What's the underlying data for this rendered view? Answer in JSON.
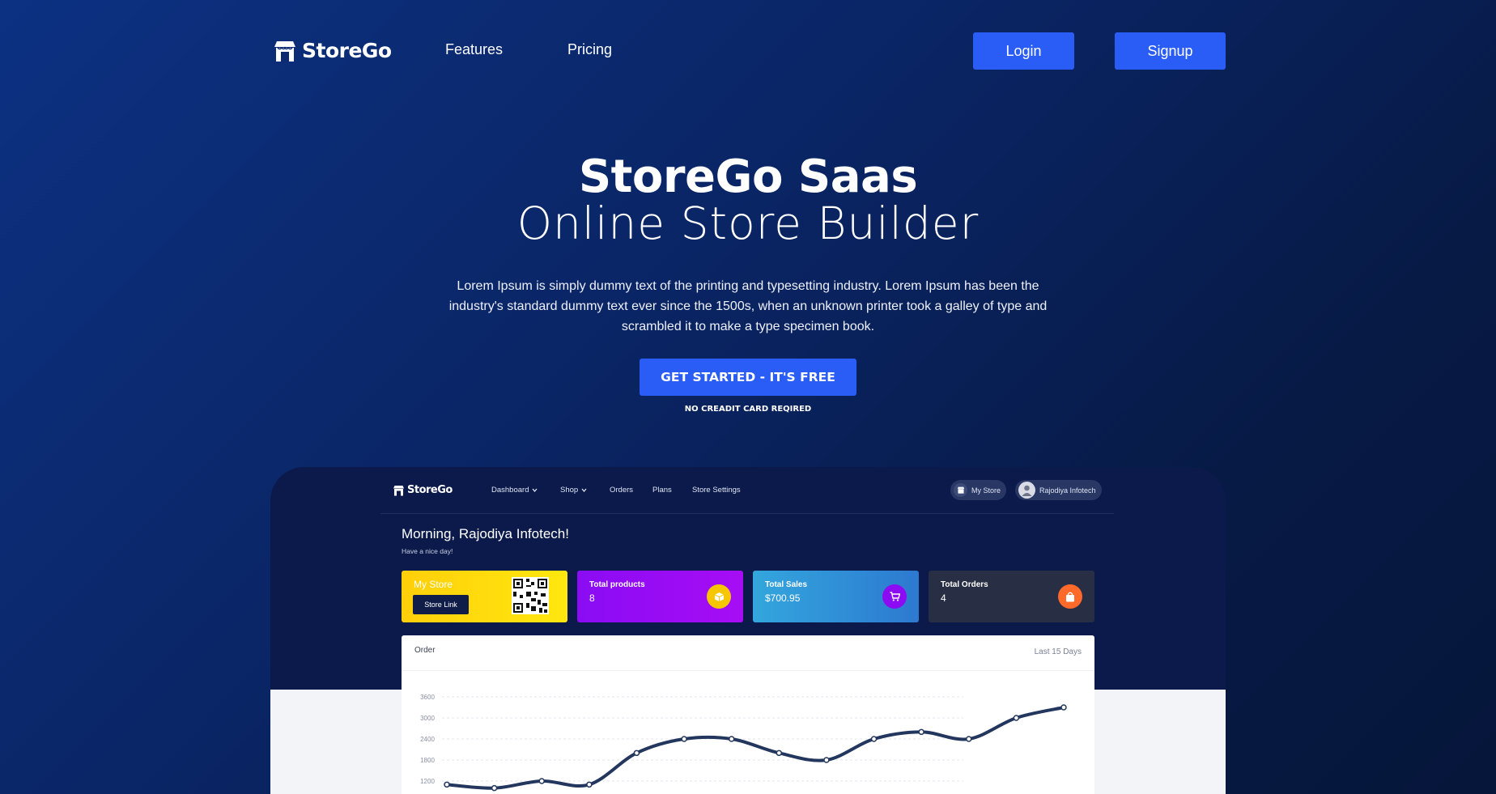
{
  "header": {
    "brand": "StoreGo",
    "nav": [
      {
        "label": "Features"
      },
      {
        "label": "Pricing"
      }
    ],
    "login_label": "Login",
    "signup_label": "Signup"
  },
  "hero": {
    "title_line1": "StoreGo Saas",
    "title_line2": "Online Store Builder",
    "description": "Lorem Ipsum is simply dummy text of the printing and typesetting industry. Lorem Ipsum has been the industry's standard dummy text ever since the 1500s, when an unknown printer took a galley of type and scrambled it to make a type specimen book.",
    "cta_label": "GET STARTED - IT'S FREE",
    "cta_note": "NO CREADIT CARD REQIRED"
  },
  "preview": {
    "brand": "StoreGo",
    "nav": [
      {
        "label": "Dashboard",
        "dropdown": true
      },
      {
        "label": "Shop",
        "dropdown": true
      },
      {
        "label": "Orders",
        "dropdown": false
      },
      {
        "label": "Plans",
        "dropdown": false
      },
      {
        "label": "Store Settings",
        "dropdown": false
      }
    ],
    "my_store_label": "My Store",
    "user_name": "Rajodiya Infotech",
    "greeting": "Morning, Rajodiya Infotech!",
    "greeting_sub": "Have a nice day!",
    "cards": {
      "my_store": {
        "title": "My Store",
        "button": "Store Link",
        "color": "#ffc40c"
      },
      "products": {
        "title": "Total products",
        "value": "8",
        "color": "#8b0cf3",
        "icon": "box-icon",
        "icon_color": "#f6c700"
      },
      "sales": {
        "title": "Total Sales",
        "value": "$700.95",
        "color": "#2f8fd8",
        "icon": "cart-icon",
        "icon_color": "#8b0cf3"
      },
      "orders": {
        "title": "Total Orders",
        "value": "4",
        "color": "#283044",
        "icon": "bag-icon",
        "icon_color": "#ff6a2a"
      }
    },
    "order_chart": {
      "title": "Order",
      "range_label": "Last 15 Days"
    }
  },
  "colors": {
    "accent": "#2a5cf6",
    "line": "#23365e"
  },
  "chart_data": {
    "type": "line",
    "title": "Order",
    "y_ticks": [
      3600,
      3000,
      2400,
      1800,
      1200
    ],
    "ylim": [
      1200,
      3600
    ],
    "series": [
      {
        "values": [
          1100,
          1000,
          1200,
          1100,
          2000,
          2400,
          2400,
          2000,
          1800,
          2400,
          2600,
          2400,
          3000,
          3300
        ]
      }
    ],
    "grid": true,
    "legend": "none"
  }
}
